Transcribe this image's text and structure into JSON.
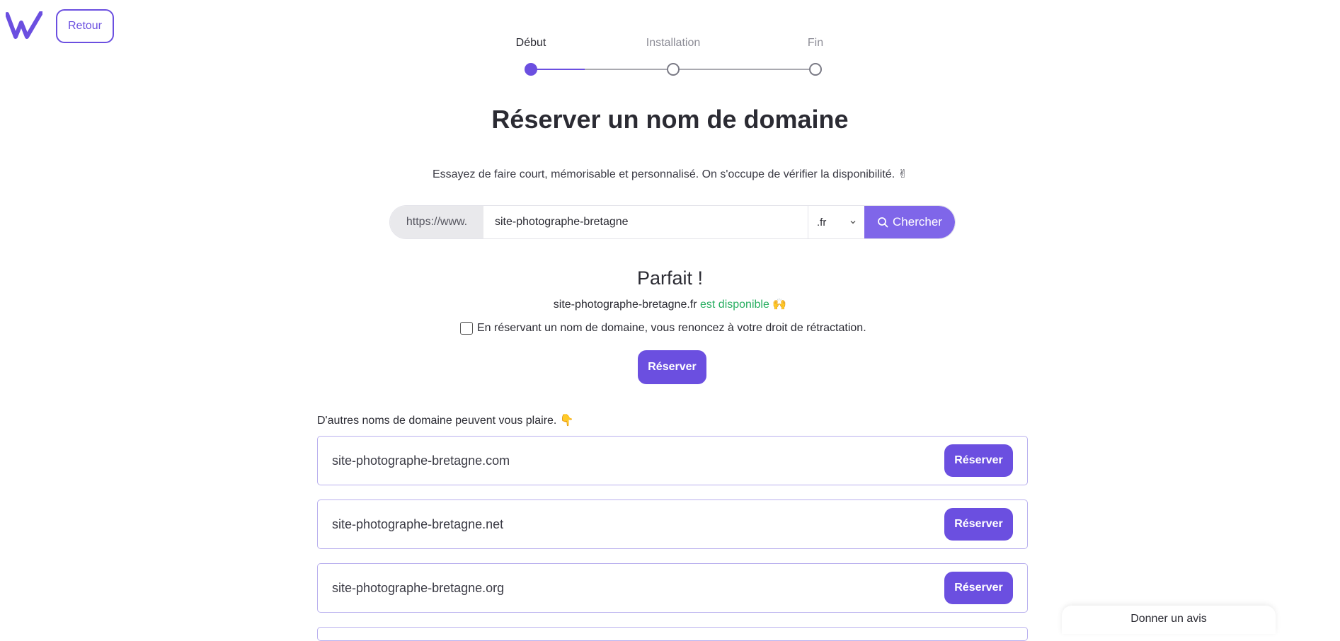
{
  "header": {
    "back_label": "Retour",
    "logo_icon": "w-logo-icon"
  },
  "stepper": {
    "steps": [
      "Début",
      "Installation",
      "Fin"
    ],
    "current_step": 1
  },
  "title": "Réserver un nom de domaine",
  "subtitle": "Essayez de faire court, mémorisable et personnalisé. On s'occupe de vérifier la disponibilité.",
  "subtitle_emoji": "✌",
  "search": {
    "prefix": "https://www.",
    "value": "site-photographe-bretagne",
    "tld": ".fr",
    "button_label": "Chercher",
    "button_icon": "search-icon"
  },
  "result": {
    "title": "Parfait !",
    "domain": "site-photographe-bretagne.fr",
    "status": "est disponible",
    "status_emoji": "🙌",
    "consent_text": "En réservant un nom de domaine, vous renoncez à votre droit de rétractation.",
    "reserve_label": "Réserver"
  },
  "suggestions": {
    "label": "D'autres noms de domaine peuvent vous plaire.",
    "label_emoji": "👇",
    "items": [
      {
        "name": "site-photographe-bretagne.com",
        "button": "Réserver"
      },
      {
        "name": "site-photographe-bretagne.net",
        "button": "Réserver"
      },
      {
        "name": "site-photographe-bretagne.org",
        "button": "Réserver"
      }
    ]
  },
  "feedback_label": "Donner un avis",
  "colors": {
    "accent": "#6b4fe0",
    "accent_light": "#7f66e9",
    "available": "#27ae60"
  }
}
